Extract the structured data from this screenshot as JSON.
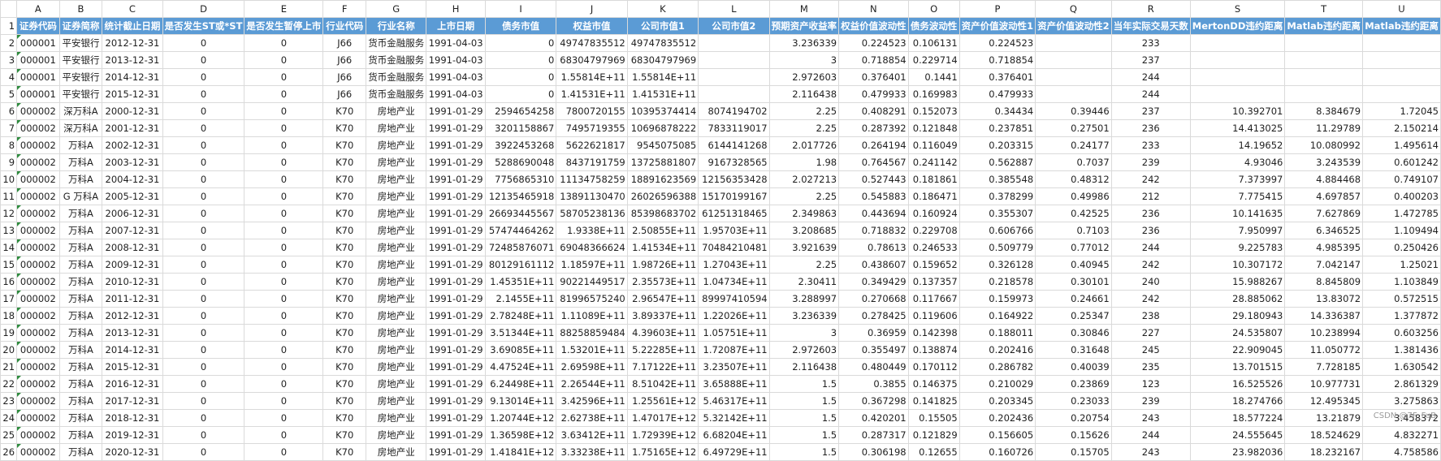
{
  "columns": [
    "A",
    "B",
    "C",
    "D",
    "E",
    "F",
    "G",
    "H",
    "I",
    "J",
    "K",
    "L",
    "M",
    "N",
    "O",
    "P",
    "Q",
    "R",
    "S",
    "T",
    "U"
  ],
  "header_row_number": "1",
  "headers": [
    "证券代码",
    "证券简称",
    "统计截止日期",
    "是否发生ST或*ST",
    "是否发生暂停上市",
    "行业代码",
    "行业名称",
    "上市日期",
    "债务市值",
    "权益市值",
    "公司市值1",
    "公司市值2",
    "预期资产收益率",
    "权益价值波动性",
    "债务波动性",
    "资产价值波动性1",
    "资产价值波动性2",
    "当年实际交易天数",
    "MertonDD违约距离",
    "Matlab违约距离",
    "Matlab违约距离"
  ],
  "rows": [
    {
      "n": "2",
      "c": [
        "000001",
        "平安银行",
        "2012-12-31",
        "0",
        "0",
        "J66",
        "货币金融服务",
        "1991-04-03",
        "0",
        "49747835512",
        "49747835512",
        "",
        "3.236339",
        "0.224523",
        "0.106131",
        "0.224523",
        "",
        "233",
        "",
        "",
        ""
      ]
    },
    {
      "n": "3",
      "c": [
        "000001",
        "平安银行",
        "2013-12-31",
        "0",
        "0",
        "J66",
        "货币金融服务",
        "1991-04-03",
        "0",
        "68304797969",
        "68304797969",
        "",
        "3",
        "0.718854",
        "0.229714",
        "0.718854",
        "",
        "237",
        "",
        "",
        ""
      ]
    },
    {
      "n": "4",
      "c": [
        "000001",
        "平安银行",
        "2014-12-31",
        "0",
        "0",
        "J66",
        "货币金融服务",
        "1991-04-03",
        "0",
        "1.55814E+11",
        "1.55814E+11",
        "",
        "2.972603",
        "0.376401",
        "0.1441",
        "0.376401",
        "",
        "244",
        "",
        "",
        ""
      ]
    },
    {
      "n": "5",
      "c": [
        "000001",
        "平安银行",
        "2015-12-31",
        "0",
        "0",
        "J66",
        "货币金融服务",
        "1991-04-03",
        "0",
        "1.41531E+11",
        "1.41531E+11",
        "",
        "2.116438",
        "0.479933",
        "0.169983",
        "0.479933",
        "",
        "244",
        "",
        "",
        ""
      ]
    },
    {
      "n": "6",
      "c": [
        "000002",
        "深万科A",
        "2000-12-31",
        "0",
        "0",
        "K70",
        "房地产业",
        "1991-01-29",
        "2594654258",
        "7800720155",
        "10395374414",
        "8074194702",
        "2.25",
        "0.408291",
        "0.152073",
        "0.34434",
        "0.39446",
        "237",
        "10.392701",
        "8.384679",
        "1.72045"
      ]
    },
    {
      "n": "7",
      "c": [
        "000002",
        "深万科A",
        "2001-12-31",
        "0",
        "0",
        "K70",
        "房地产业",
        "1991-01-29",
        "3201158867",
        "7495719355",
        "10696878222",
        "7833119017",
        "2.25",
        "0.287392",
        "0.121848",
        "0.237851",
        "0.27501",
        "236",
        "14.413025",
        "11.29789",
        "2.150214"
      ]
    },
    {
      "n": "8",
      "c": [
        "000002",
        "万科A",
        "2002-12-31",
        "0",
        "0",
        "K70",
        "房地产业",
        "1991-01-29",
        "3922453268",
        "5622621817",
        "9545075085",
        "6144141268",
        "2.017726",
        "0.264194",
        "0.116049",
        "0.203315",
        "0.24177",
        "233",
        "14.19652",
        "10.080992",
        "1.495614"
      ]
    },
    {
      "n": "9",
      "c": [
        "000002",
        "万科A",
        "2003-12-31",
        "0",
        "0",
        "K70",
        "房地产业",
        "1991-01-29",
        "5288690048",
        "8437191759",
        "13725881807",
        "9167328565",
        "1.98",
        "0.764567",
        "0.241142",
        "0.562887",
        "0.7037",
        "239",
        "4.93046",
        "3.243539",
        "0.601242"
      ]
    },
    {
      "n": "10",
      "c": [
        "000002",
        "万科A",
        "2004-12-31",
        "0",
        "0",
        "K70",
        "房地产业",
        "1991-01-29",
        "7756865310",
        "11134758259",
        "18891623569",
        "12156353428",
        "2.027213",
        "0.527443",
        "0.181861",
        "0.385548",
        "0.48312",
        "242",
        "7.373997",
        "4.884468",
        "0.749107"
      ]
    },
    {
      "n": "11",
      "c": [
        "000002",
        "G 万科A",
        "2005-12-31",
        "0",
        "0",
        "K70",
        "房地产业",
        "1991-01-29",
        "12135465918",
        "13891130470",
        "26026596388",
        "15170199167",
        "2.25",
        "0.545883",
        "0.186471",
        "0.378299",
        "0.49986",
        "212",
        "7.775415",
        "4.697857",
        "0.400203"
      ]
    },
    {
      "n": "12",
      "c": [
        "000002",
        "万科A",
        "2006-12-31",
        "0",
        "0",
        "K70",
        "房地产业",
        "1991-01-29",
        "26693445567",
        "58705238136",
        "85398683702",
        "61251318465",
        "2.349863",
        "0.443694",
        "0.160924",
        "0.355307",
        "0.42525",
        "236",
        "10.141635",
        "7.627869",
        "1.472785"
      ]
    },
    {
      "n": "13",
      "c": [
        "000002",
        "万科A",
        "2007-12-31",
        "0",
        "0",
        "K70",
        "房地产业",
        "1991-01-29",
        "57474464262",
        "1.9338E+11",
        "2.50855E+11",
        "1.95703E+11",
        "3.208685",
        "0.718832",
        "0.229708",
        "0.606766",
        "0.7103",
        "236",
        "7.950997",
        "6.346525",
        "1.109494"
      ]
    },
    {
      "n": "14",
      "c": [
        "000002",
        "万科A",
        "2008-12-31",
        "0",
        "0",
        "K70",
        "房地产业",
        "1991-01-29",
        "72485876071",
        "69048366624",
        "1.41534E+11",
        "70484210481",
        "3.921639",
        "0.78613",
        "0.246533",
        "0.509779",
        "0.77012",
        "244",
        "9.225783",
        "4.985395",
        "0.250426"
      ]
    },
    {
      "n": "15",
      "c": [
        "000002",
        "万科A",
        "2009-12-31",
        "0",
        "0",
        "K70",
        "房地产业",
        "1991-01-29",
        "80129161112",
        "1.18597E+11",
        "1.98726E+11",
        "1.27043E+11",
        "2.25",
        "0.438607",
        "0.159652",
        "0.326128",
        "0.40945",
        "242",
        "10.307172",
        "7.042147",
        "1.25021"
      ]
    },
    {
      "n": "16",
      "c": [
        "000002",
        "万科A",
        "2010-12-31",
        "0",
        "0",
        "K70",
        "房地产业",
        "1991-01-29",
        "1.45351E+11",
        "90221449517",
        "2.35573E+11",
        "1.04734E+11",
        "2.30411",
        "0.349429",
        "0.137357",
        "0.218578",
        "0.30101",
        "240",
        "15.988267",
        "8.845809",
        "1.103849"
      ]
    },
    {
      "n": "17",
      "c": [
        "000002",
        "万科A",
        "2011-12-31",
        "0",
        "0",
        "K70",
        "房地产业",
        "1991-01-29",
        "2.1455E+11",
        "81996575240",
        "2.96547E+11",
        "89997410594",
        "3.288997",
        "0.270668",
        "0.117667",
        "0.159973",
        "0.24661",
        "242",
        "28.885062",
        "13.83072",
        "0.572515"
      ]
    },
    {
      "n": "18",
      "c": [
        "000002",
        "万科A",
        "2012-12-31",
        "0",
        "0",
        "K70",
        "房地产业",
        "1991-01-29",
        "2.78248E+11",
        "1.11089E+11",
        "3.89337E+11",
        "1.22026E+11",
        "3.236339",
        "0.278425",
        "0.119606",
        "0.164922",
        "0.25347",
        "238",
        "29.180943",
        "14.336387",
        "1.377872"
      ]
    },
    {
      "n": "19",
      "c": [
        "000002",
        "万科A",
        "2013-12-31",
        "0",
        "0",
        "K70",
        "房地产业",
        "1991-01-29",
        "3.51344E+11",
        "88258859484",
        "4.39603E+11",
        "1.05751E+11",
        "3",
        "0.36959",
        "0.142398",
        "0.188011",
        "0.30846",
        "227",
        "24.535807",
        "10.238994",
        "0.603256"
      ]
    },
    {
      "n": "20",
      "c": [
        "000002",
        "万科A",
        "2014-12-31",
        "0",
        "0",
        "K70",
        "房地产业",
        "1991-01-29",
        "3.69085E+11",
        "1.53201E+11",
        "5.22285E+11",
        "1.72087E+11",
        "2.972603",
        "0.355497",
        "0.138874",
        "0.202416",
        "0.31648",
        "245",
        "22.909045",
        "11.050772",
        "1.381436"
      ]
    },
    {
      "n": "21",
      "c": [
        "000002",
        "万科A",
        "2015-12-31",
        "0",
        "0",
        "K70",
        "房地产业",
        "1991-01-29",
        "4.47524E+11",
        "2.69598E+11",
        "7.17122E+11",
        "3.23507E+11",
        "2.116438",
        "0.480449",
        "0.170112",
        "0.286782",
        "0.40039",
        "235",
        "13.701515",
        "7.728185",
        "1.630542"
      ]
    },
    {
      "n": "22",
      "c": [
        "000002",
        "万科A",
        "2016-12-31",
        "0",
        "0",
        "K70",
        "房地产业",
        "1991-01-29",
        "6.24498E+11",
        "2.26544E+11",
        "8.51042E+11",
        "3.65888E+11",
        "1.5",
        "0.3855",
        "0.146375",
        "0.210029",
        "0.23869",
        "123",
        "16.525526",
        "10.977731",
        "2.861329"
      ]
    },
    {
      "n": "23",
      "c": [
        "000002",
        "万科A",
        "2017-12-31",
        "0",
        "0",
        "K70",
        "房地产业",
        "1991-01-29",
        "9.13014E+11",
        "3.42596E+11",
        "1.25561E+12",
        "5.46317E+11",
        "1.5",
        "0.367298",
        "0.141825",
        "0.203345",
        "0.23033",
        "239",
        "18.274766",
        "12.495345",
        "3.275863"
      ]
    },
    {
      "n": "24",
      "c": [
        "000002",
        "万科A",
        "2018-12-31",
        "0",
        "0",
        "K70",
        "房地产业",
        "1991-01-29",
        "1.20744E+12",
        "2.62738E+11",
        "1.47017E+12",
        "5.32142E+11",
        "1.5",
        "0.420201",
        "0.15505",
        "0.202436",
        "0.20754",
        "243",
        "18.577224",
        "13.21879",
        "3.458372"
      ]
    },
    {
      "n": "25",
      "c": [
        "000002",
        "万科A",
        "2019-12-31",
        "0",
        "0",
        "K70",
        "房地产业",
        "1991-01-29",
        "1.36598E+12",
        "3.63412E+11",
        "1.72939E+12",
        "6.68204E+11",
        "1.5",
        "0.287317",
        "0.121829",
        "0.156605",
        "0.15626",
        "244",
        "24.555645",
        "18.524629",
        "4.832271"
      ]
    },
    {
      "n": "26",
      "c": [
        "000002",
        "万科A",
        "2020-12-31",
        "0",
        "0",
        "K70",
        "房地产业",
        "1991-01-29",
        "1.41841E+12",
        "3.33238E+11",
        "1.75165E+12",
        "6.49729E+11",
        "1.5",
        "0.306198",
        "0.12655",
        "0.160726",
        "0.15705",
        "243",
        "23.982036",
        "18.232167",
        "4.758586"
      ]
    }
  ],
  "watermark": "CSDN @7F_FuB"
}
